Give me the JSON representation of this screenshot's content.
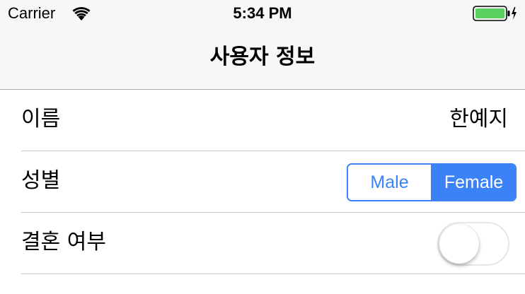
{
  "status_bar": {
    "carrier": "Carrier",
    "time": "5:34 PM",
    "wifi_icon": "wifi-icon",
    "battery_icon": "battery-charging-icon",
    "battery_color": "#5ad05e"
  },
  "nav": {
    "title": "사용자 정보"
  },
  "rows": {
    "name": {
      "label": "이름",
      "value": "한예지"
    },
    "gender": {
      "label": "성별",
      "options": [
        "Male",
        "Female"
      ],
      "selected": "Female"
    },
    "married": {
      "label": "결혼 여부",
      "toggle_on": false
    }
  },
  "colors": {
    "accent": "#3a82f6",
    "separator": "#c8c7cc",
    "bar_background": "#f7f7f7"
  }
}
